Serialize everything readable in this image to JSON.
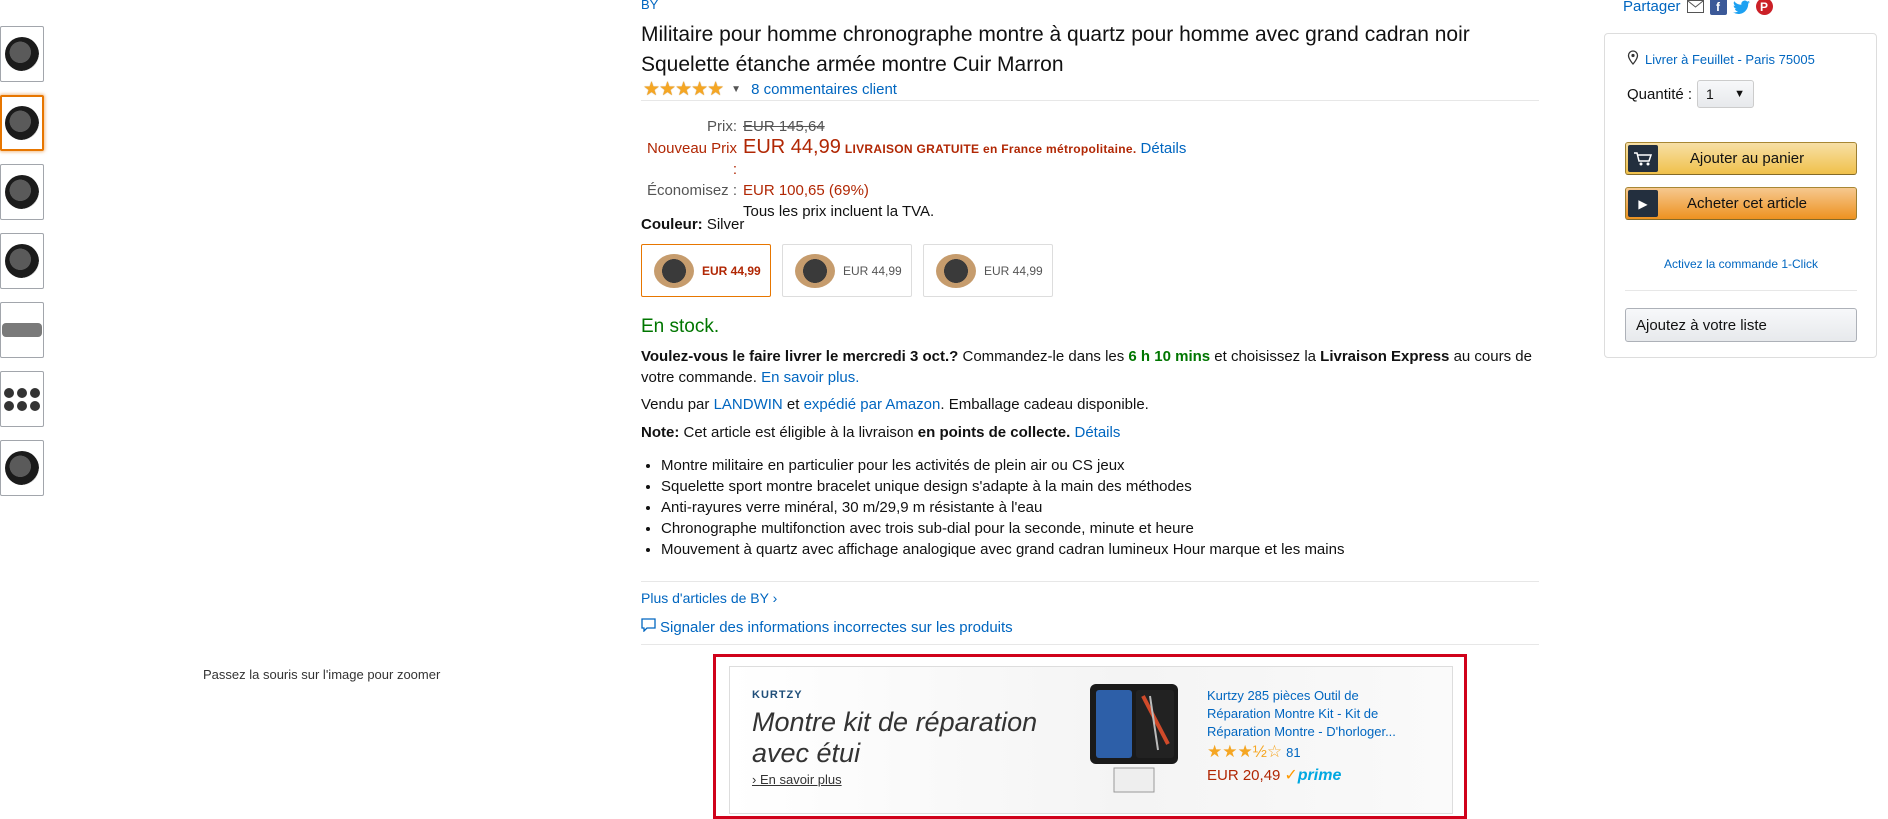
{
  "thumbnails": [
    "watch-front",
    "watch-side",
    "watch-angle",
    "watch-dial",
    "watch-strap",
    "watch-set",
    "watch-box"
  ],
  "zoom_hint": "Passez la souris sur l'image pour zoomer",
  "product": {
    "brand": "BY",
    "title": "Militaire pour homme chronographe montre à quartz pour homme avec grand cadran noir Squelette étanche armée montre Cuir Marron",
    "stars": "★★★★★",
    "reviews": "8 commentaires client"
  },
  "price": {
    "label_old": "Prix:",
    "old": "EUR 145,64",
    "label_new": "Nouveau Prix :",
    "new": "EUR 44,99",
    "free_shipping": "LIVRAISON GRATUITE en France métropolitaine.",
    "details": "Détails",
    "label_save": "Économisez :",
    "save": "EUR 100,65 (69%)",
    "tax_note": "Tous les prix incluent la TVA."
  },
  "color": {
    "label": "Couleur:",
    "value": "Silver",
    "options": [
      {
        "price": "EUR 44,99",
        "selected": true
      },
      {
        "price": "EUR 44,99",
        "selected": false
      },
      {
        "price": "EUR 44,99",
        "selected": false
      }
    ]
  },
  "stock": "En stock.",
  "delivery": {
    "q": "Voulez-vous le faire livrer le mercredi 3 oct.?",
    "p1": " Commandez-le dans les ",
    "time": "6 h 10 mins",
    "p2": " et choisissez la ",
    "express": "Livraison Express",
    "p3": " au cours de votre commande. ",
    "learn": "En savoir plus."
  },
  "sold_by": {
    "p1": "Vendu par ",
    "seller": "LANDWIN",
    "p2": " et ",
    "fulfilled": "expédié par Amazon",
    "p3": ". Emballage cadeau disponible."
  },
  "note": {
    "label": "Note:",
    "p1": " Cet article est éligible à la livraison ",
    "bold": "en points de collecte.",
    "details": "Détails"
  },
  "bullets": [
    "Montre militaire en particulier pour les activités de plein air ou CS jeux",
    "Squelette sport montre bracelet unique design s'adapte à la main des méthodes",
    "Anti-rayures verre minéral, 30 m/29,9 m résistante à l'eau",
    "Chronographe multifonction avec trois sub-dial pour la seconde, minute et heure",
    "Mouvement à quartz avec affichage analogique avec grand cadran lumineux Hour marque et les mains"
  ],
  "more_from": "Plus d'articles de BY",
  "report": "Signaler des informations incorrectes sur les produits",
  "ad": {
    "brand": "KURTZY",
    "headline": "Montre kit de réparation avec étui",
    "learn_more": "En savoir plus",
    "product_title": "Kurtzy 285 pièces Outil de Réparation Montre Kit - Kit de Réparation Montre - D'horloger...",
    "stars": "★★★½☆",
    "rating_count": "81",
    "price": "EUR 20,49",
    "prime": "prime"
  },
  "share": {
    "label": "Partager"
  },
  "buybox": {
    "deliver_to": "Livrer à Feuillet - Paris 75005",
    "qty_label": "Quantité :",
    "qty_value": "1",
    "add_to_cart": "Ajouter au panier",
    "buy_now": "Acheter cet article",
    "one_click": "Activez la commande 1-Click",
    "add_to_list": "Ajoutez à votre liste"
  },
  "colors": {
    "accent_orange": "#e77600",
    "price_red": "#b12704",
    "link_blue": "#0066c0",
    "stock_green": "#007600",
    "ad_outline": "#d0021b"
  }
}
